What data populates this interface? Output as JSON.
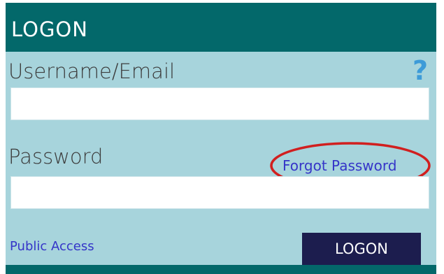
{
  "header": {
    "title": "LOGON"
  },
  "username": {
    "label": "Username/Email",
    "value": "",
    "help_icon": {
      "name": "question-mark-icon",
      "glyph": "?"
    }
  },
  "password": {
    "label": "Password",
    "value": "",
    "forgot_link": "Forgot Password"
  },
  "footer": {
    "public_access_link": "Public Access",
    "logon_button": "LOGON"
  },
  "annotation": {
    "shape": "ellipse",
    "color": "#d11f1f"
  },
  "colors": {
    "header_bg": "#03686a",
    "body_bg": "#a7d4dc",
    "link": "#3535c8",
    "button_bg": "#1c1d4e",
    "help_icon": "#3d9bd8"
  }
}
